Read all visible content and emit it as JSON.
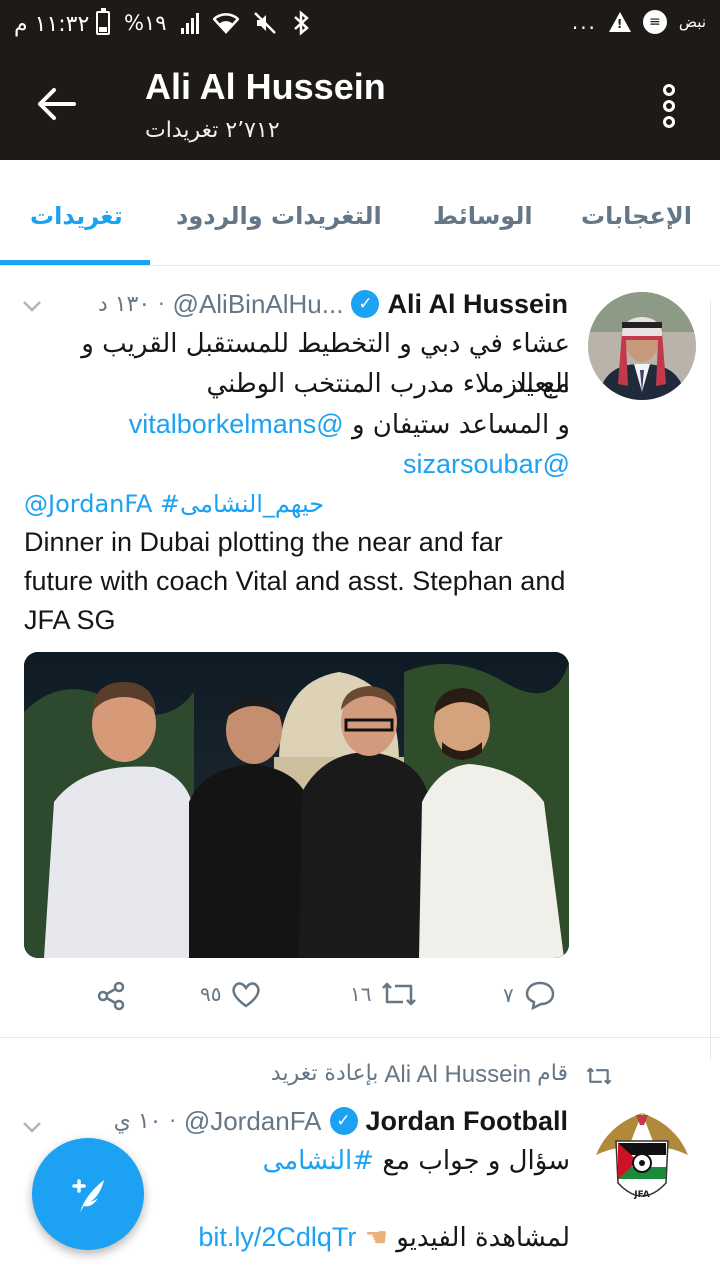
{
  "status_bar": {
    "time": "١١:٣٢ م",
    "battery": "%١٩",
    "carrier": "نبض"
  },
  "header": {
    "title": "Ali Al Hussein",
    "subtitle": "٢٬٧١٢ تغريدات"
  },
  "tabs": [
    {
      "label": "تغريدات",
      "active": true
    },
    {
      "label": "التغريدات والردود",
      "active": false
    },
    {
      "label": "الوسائط",
      "active": false
    },
    {
      "label": "الإعجابات",
      "active": false
    }
  ],
  "tweet": {
    "name": "Ali Al Hussein",
    "handle": "@AliBinAlHu...",
    "time": "١٣٠ د",
    "line1": "عشاء في دبي و التخطيط للمستقبل القريب و البعيد",
    "line2": "مع الزملاء مدرب المنتخب الوطني",
    "line3_mention": "@vitalborkelmans",
    "line3_text": "و المساعد ستيفان و",
    "line4_mention": "@sizarsoubar",
    "hashtags": "@JordanFA #حيهم_النشامى",
    "english": "Dinner in Dubai plotting the near and far future with coach Vital and asst. Stephan and JFA SG",
    "replies": "٧",
    "retweets": "١٦",
    "likes": "٩٥"
  },
  "retweet": {
    "retweeter": "Ali Al Hussein",
    "retweeted_label": "قام",
    "retweeted_suffix": "بإعادة تغريد",
    "name": "Jordan Football",
    "handle": "@JordanFA",
    "time": "١٠ ي",
    "line1_text": "سؤال و جواب مع",
    "line1_hashtag": "#النشامى",
    "line2_text": "لمشاهدة الفيديو",
    "line2_link": "bit.ly/2CdlqTr",
    "logo_text": "JFA"
  },
  "colors": {
    "header_bg": "#1e1b17",
    "accent": "#1da1f2",
    "muted": "#657786"
  }
}
